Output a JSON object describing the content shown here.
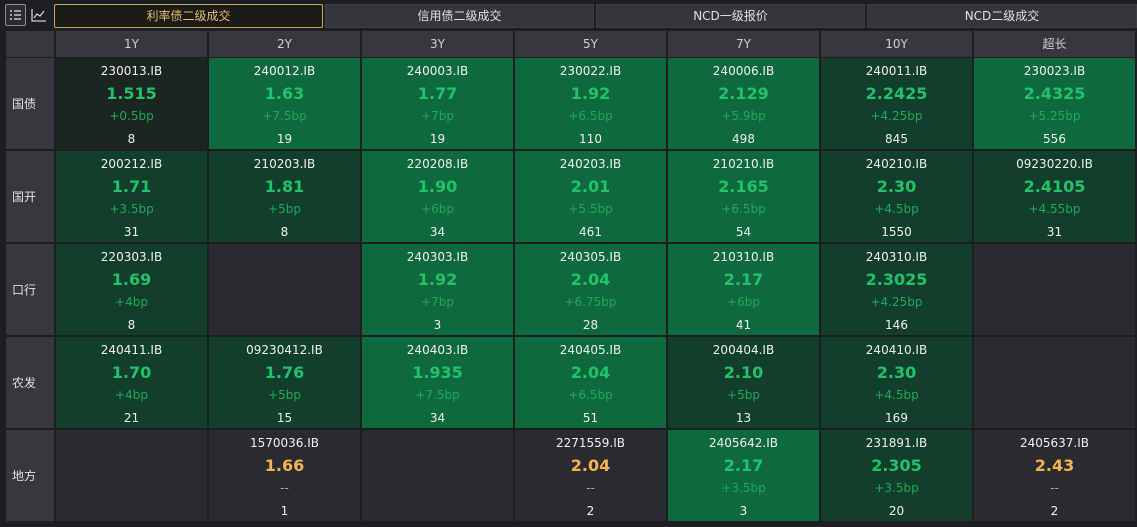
{
  "toolbar": {
    "tabs": [
      "利率债二级成交",
      "信用债二级成交",
      "NCD一级报价",
      "NCD二级成交"
    ],
    "active_tab": 0
  },
  "colors": {
    "tone_dark": "#1b2522",
    "tone_mid": "#113f2b",
    "tone_bright": "#0e6a3d",
    "tone_empty": "#292b2f",
    "yield_green": "#21c26b",
    "yield_orange": "#f2b452",
    "chg_green": "#1fa85c",
    "chg_muted": "#a8a8a8"
  },
  "columns": [
    "1Y",
    "2Y",
    "3Y",
    "5Y",
    "7Y",
    "10Y",
    "超长"
  ],
  "rows": [
    {
      "label": "国债",
      "cells": [
        {
          "code": "230013.IB",
          "yield": "1.515",
          "chg": "+0.5bp",
          "vol": "8",
          "tone": "dark"
        },
        {
          "code": "240012.IB",
          "yield": "1.63",
          "chg": "+7.5bp",
          "vol": "19",
          "tone": "bright"
        },
        {
          "code": "240003.IB",
          "yield": "1.77",
          "chg": "+7bp",
          "vol": "19",
          "tone": "bright"
        },
        {
          "code": "230022.IB",
          "yield": "1.92",
          "chg": "+6.5bp",
          "vol": "110",
          "tone": "bright"
        },
        {
          "code": "240006.IB",
          "yield": "2.129",
          "chg": "+5.9bp",
          "vol": "498",
          "tone": "bright"
        },
        {
          "code": "240011.IB",
          "yield": "2.2425",
          "chg": "+4.25bp",
          "vol": "845",
          "tone": "mid"
        },
        {
          "code": "230023.IB",
          "yield": "2.4325",
          "chg": "+5.25bp",
          "vol": "556",
          "tone": "bright"
        }
      ]
    },
    {
      "label": "国开",
      "cells": [
        {
          "code": "200212.IB",
          "yield": "1.71",
          "chg": "+3.5bp",
          "vol": "31",
          "tone": "mid"
        },
        {
          "code": "210203.IB",
          "yield": "1.81",
          "chg": "+5bp",
          "vol": "8",
          "tone": "mid"
        },
        {
          "code": "220208.IB",
          "yield": "1.90",
          "chg": "+6bp",
          "vol": "34",
          "tone": "bright"
        },
        {
          "code": "240203.IB",
          "yield": "2.01",
          "chg": "+5.5bp",
          "vol": "461",
          "tone": "bright"
        },
        {
          "code": "210210.IB",
          "yield": "2.165",
          "chg": "+6.5bp",
          "vol": "54",
          "tone": "bright"
        },
        {
          "code": "240210.IB",
          "yield": "2.30",
          "chg": "+4.5bp",
          "vol": "1550",
          "tone": "mid"
        },
        {
          "code": "09230220.IB",
          "yield": "2.4105",
          "chg": "+4.55bp",
          "vol": "31",
          "tone": "mid"
        }
      ]
    },
    {
      "label": "口行",
      "cells": [
        {
          "code": "220303.IB",
          "yield": "1.69",
          "chg": "+4bp",
          "vol": "8",
          "tone": "mid"
        },
        null,
        {
          "code": "240303.IB",
          "yield": "1.92",
          "chg": "+7bp",
          "vol": "3",
          "tone": "bright"
        },
        {
          "code": "240305.IB",
          "yield": "2.04",
          "chg": "+6.75bp",
          "vol": "28",
          "tone": "bright"
        },
        {
          "code": "210310.IB",
          "yield": "2.17",
          "chg": "+6bp",
          "vol": "41",
          "tone": "bright"
        },
        {
          "code": "240310.IB",
          "yield": "2.3025",
          "chg": "+4.25bp",
          "vol": "146",
          "tone": "mid"
        },
        null
      ]
    },
    {
      "label": "农发",
      "cells": [
        {
          "code": "240411.IB",
          "yield": "1.70",
          "chg": "+4bp",
          "vol": "21",
          "tone": "mid"
        },
        {
          "code": "09230412.IB",
          "yield": "1.76",
          "chg": "+5bp",
          "vol": "15",
          "tone": "mid"
        },
        {
          "code": "240403.IB",
          "yield": "1.935",
          "chg": "+7.5bp",
          "vol": "34",
          "tone": "bright"
        },
        {
          "code": "240405.IB",
          "yield": "2.04",
          "chg": "+6.5bp",
          "vol": "51",
          "tone": "bright"
        },
        {
          "code": "200404.IB",
          "yield": "2.10",
          "chg": "+5bp",
          "vol": "13",
          "tone": "mid"
        },
        {
          "code": "240410.IB",
          "yield": "2.30",
          "chg": "+4.5bp",
          "vol": "169",
          "tone": "mid"
        },
        null
      ]
    },
    {
      "label": "地方",
      "cells": [
        null,
        {
          "code": "1570036.IB",
          "yield": "1.66",
          "chg": "--",
          "vol": "1",
          "tone": "grey",
          "yc": "orange"
        },
        null,
        {
          "code": "2271559.IB",
          "yield": "2.04",
          "chg": "--",
          "vol": "2",
          "tone": "grey",
          "yc": "orange"
        },
        {
          "code": "2405642.IB",
          "yield": "2.17",
          "chg": "+3.5bp",
          "vol": "3",
          "tone": "bright"
        },
        {
          "code": "231891.IB",
          "yield": "2.305",
          "chg": "+3.5bp",
          "vol": "20",
          "tone": "mid"
        },
        {
          "code": "2405637.IB",
          "yield": "2.43",
          "chg": "--",
          "vol": "2",
          "tone": "grey",
          "yc": "orange"
        }
      ]
    }
  ]
}
